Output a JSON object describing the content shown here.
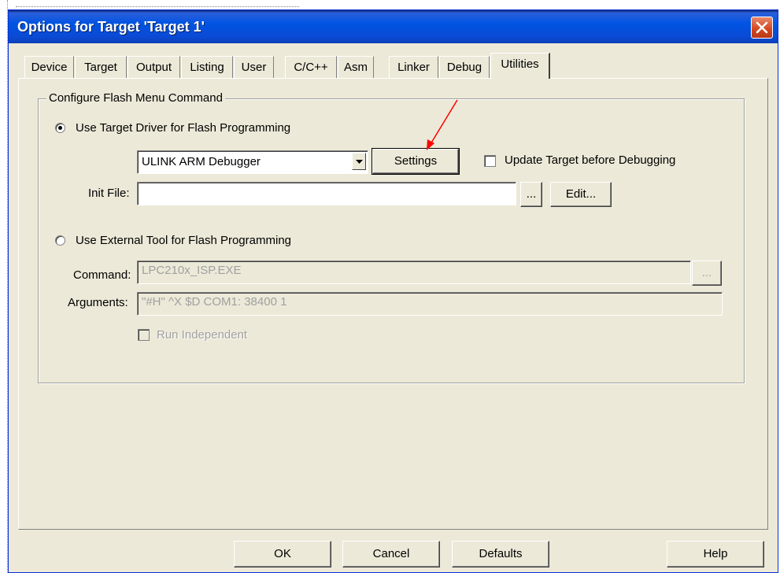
{
  "window": {
    "title": "Options for Target 'Target 1'"
  },
  "tabs": [
    {
      "label": "Device"
    },
    {
      "label": "Target"
    },
    {
      "label": "Output"
    },
    {
      "label": "Listing"
    },
    {
      "label": "User"
    },
    {
      "label": "C/C++"
    },
    {
      "label": "Asm"
    },
    {
      "label": "Linker"
    },
    {
      "label": "Debug"
    },
    {
      "label": "Utilities",
      "active": true
    }
  ],
  "flash": {
    "group_label": "Configure Flash Menu Command",
    "use_target_driver_label": "Use Target Driver for Flash Programming",
    "use_target_driver_selected": true,
    "driver_selected": "ULINK ARM Debugger",
    "settings_label": "Settings",
    "update_target_label": "Update Target before Debugging",
    "update_target_checked": false,
    "init_file_label": "Init File:",
    "init_file_value": "",
    "browse_label": "...",
    "edit_label": "Edit...",
    "use_external_label": "Use External Tool for Flash Programming",
    "use_external_selected": false,
    "command_label": "Command:",
    "command_value": "LPC210x_ISP.EXE",
    "arguments_label": "Arguments:",
    "arguments_value": "\"#H\" ^X $D COM1: 38400 1",
    "run_independent_label": "Run Independent",
    "run_independent_checked": false
  },
  "footer": {
    "ok_label": "OK",
    "cancel_label": "Cancel",
    "defaults_label": "Defaults",
    "help_label": "Help"
  },
  "colors": {
    "titlebar": "#0054e3",
    "dialog_bg": "#ece9d8",
    "annotation_arrow": "#ff0000"
  }
}
